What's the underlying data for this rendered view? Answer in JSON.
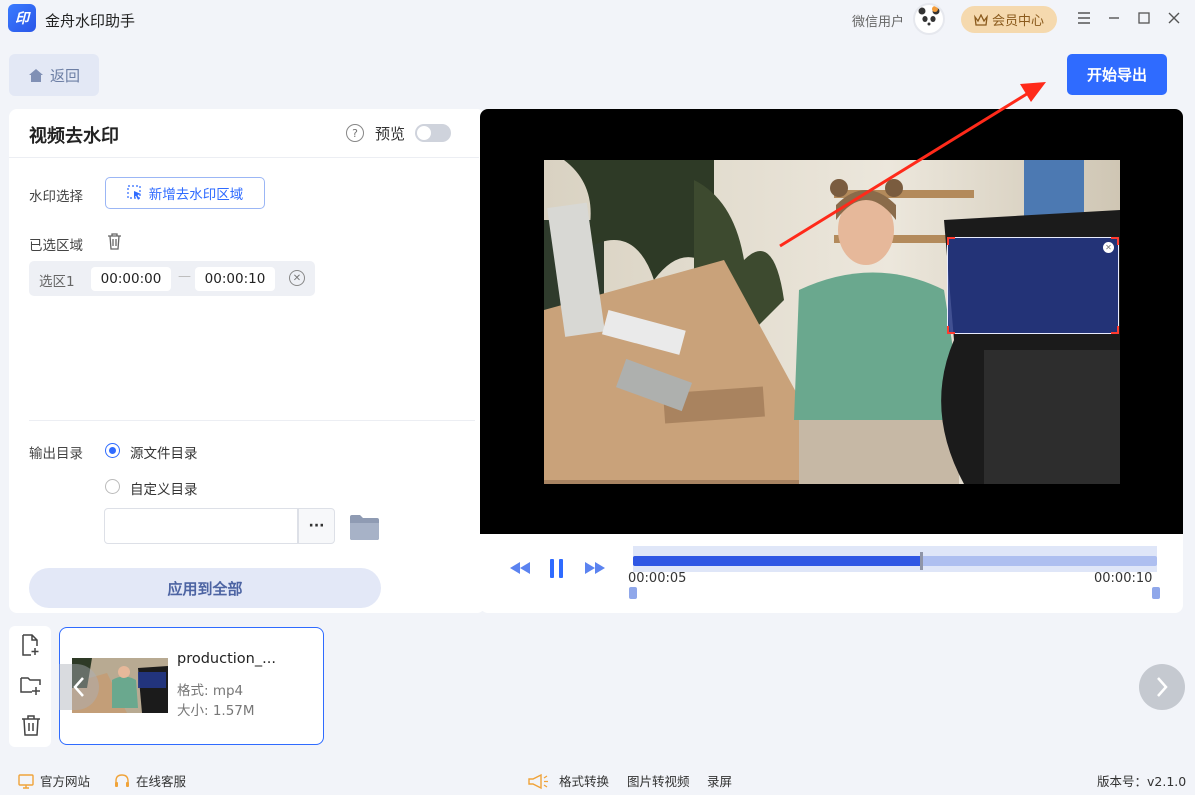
{
  "app": {
    "logo_text": "印",
    "title": "金舟水印助手"
  },
  "header": {
    "user_name": "微信用户",
    "vip_label": "会员中心"
  },
  "toolbar": {
    "back_label": "返回",
    "export_label": "开始导出"
  },
  "panel": {
    "title": "视频去水印",
    "preview_label": "预览",
    "watermark_select_label": "水印选择",
    "add_area_label": "新增去水印区域",
    "selected_area_label": "已选区域",
    "regions": [
      {
        "name": "选区1",
        "start": "00:00:00",
        "end": "00:00:10"
      }
    ],
    "output_dir_label": "输出目录",
    "radio_source": "源文件目录",
    "radio_custom": "自定义目录",
    "path_value": "",
    "dots_label": "···",
    "apply_all_label": "应用到全部"
  },
  "player": {
    "current_time": "00:00:05",
    "end_time": "00:00:10",
    "progress": 0.55
  },
  "file": {
    "name": "production_...",
    "format": "格式: mp4",
    "size": "大小: 1.57M"
  },
  "footer": {
    "official_site": "官方网站",
    "online_service": "在线客服",
    "format_convert": "格式转换",
    "image_to_video": "图片转视频",
    "record": "录屏",
    "version": "版本号：v2.1.0"
  },
  "colors": {
    "accent": "#2f6bff",
    "vip_bg": "#f5d9ae",
    "annotation_arrow": "#ff2a1a"
  }
}
